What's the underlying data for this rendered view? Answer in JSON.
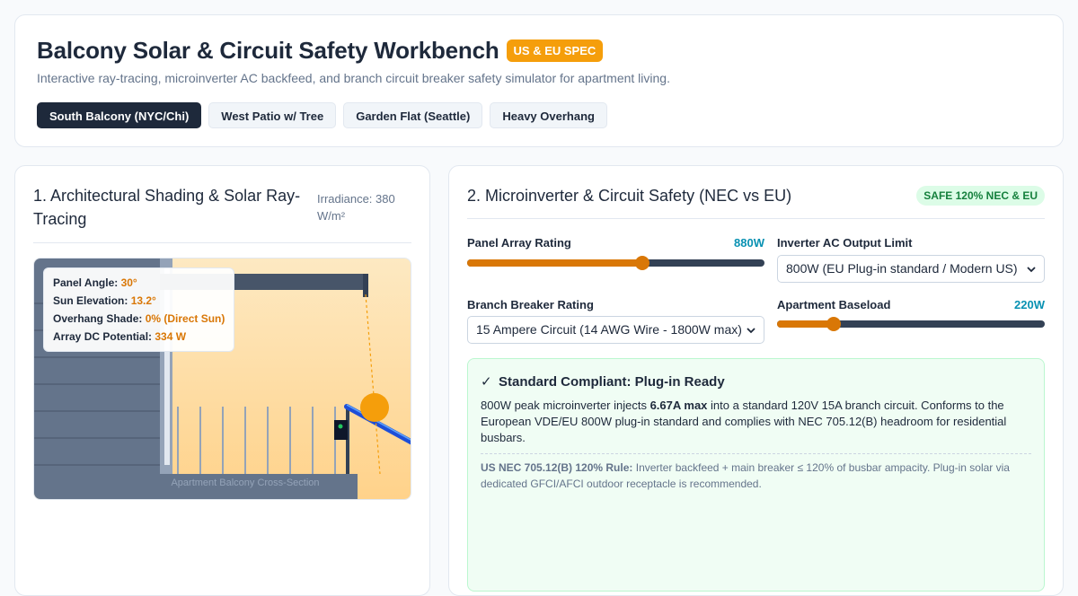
{
  "header": {
    "title": "Balcony Solar & Circuit Safety Workbench",
    "spec_badge": "US & EU SPEC",
    "subtitle": "Interactive ray-tracing, microinverter AC backfeed, and branch circuit breaker safety simulator for apartment living.",
    "scenarios": [
      {
        "label": "South Balcony (NYC/Chi)",
        "active": true
      },
      {
        "label": "West Patio w/ Tree",
        "active": false
      },
      {
        "label": "Garden Flat (Seattle)",
        "active": false
      },
      {
        "label": "Heavy Overhang",
        "active": false
      }
    ]
  },
  "shading": {
    "title": "1. Architectural Shading & Solar Ray-Tracing",
    "irradiance": "Irradiance: 380 W/m²",
    "overlay": {
      "panel_angle_label": "Panel Angle:",
      "panel_angle_value": "30°",
      "sun_elevation_label": "Sun Elevation:",
      "sun_elevation_value": "13.2°",
      "overhang_label": "Overhang Shade:",
      "overhang_value": "0% (Direct Sun)",
      "array_label": "Array DC Potential:",
      "array_value": "334 W"
    },
    "caption": "Apartment Balcony Cross-Section"
  },
  "circuit": {
    "title": "2. Microinverter & Circuit Safety (NEC vs EU)",
    "status_badge": "SAFE 120% NEC & EU",
    "panel_rating": {
      "label": "Panel Array Rating",
      "value_text": "880W",
      "fraction": 0.59
    },
    "inverter_limit": {
      "label": "Inverter AC Output Limit",
      "selected": "800W (EU Plug-in standard / Modern US)"
    },
    "breaker": {
      "label": "Branch Breaker Rating",
      "selected": "15 Ampere Circuit (14 AWG Wire - 1800W max)"
    },
    "baseload": {
      "label": "Apartment Baseload",
      "value_text": "220W",
      "fraction": 0.21
    },
    "notice": {
      "title": "Standard Compliant: Plug-in Ready",
      "body_pre": "800W peak microinverter injects ",
      "body_bold": "6.67A max",
      "body_post": " into a standard 120V 15A branch circuit. Conforms to the European VDE/EU 800W plug-in standard and complies with NEC 705.12(B) headroom for residential busbars.",
      "rule_label": "US NEC 705.12(B) 120% Rule:",
      "rule_text": " Inverter backfeed + main breaker ≤ 120% of busbar ampacity. Plug-in solar via dedicated GFCI/AFCI outdoor receptacle is recommended."
    }
  },
  "colors": {
    "accent": "#d97706",
    "brand_dark": "#1e293b",
    "safe_green": "#15803d",
    "value_cyan": "#0891b2",
    "badge_orange": "#f59e0b"
  }
}
